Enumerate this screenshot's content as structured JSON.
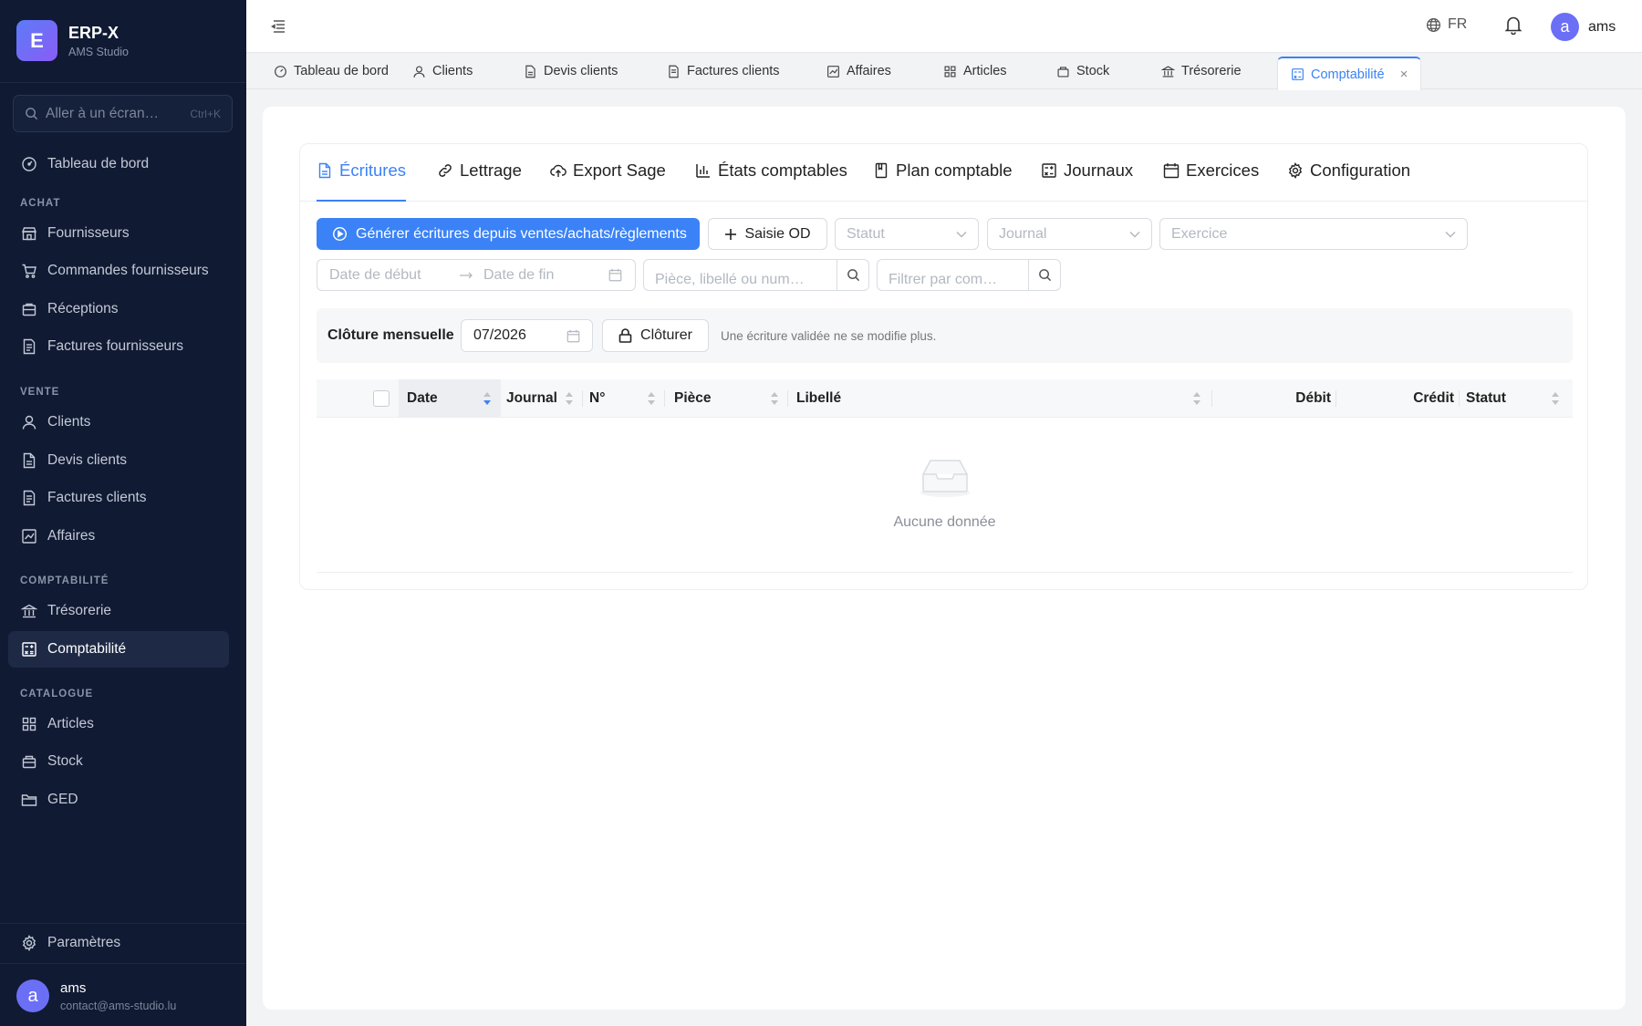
{
  "brand": {
    "logo_letter": "E",
    "name": "ERP-X",
    "subtitle": "AMS Studio"
  },
  "sidebar": {
    "search": {
      "placeholder": "Aller à un écran…",
      "shortcut": "Ctrl+K"
    },
    "top_item": {
      "label": "Tableau de bord",
      "icon": "dashboard-icon"
    },
    "sections": [
      {
        "title": "ACHAT",
        "items": [
          {
            "label": "Fournisseurs",
            "icon": "store-icon"
          },
          {
            "label": "Commandes fournisseurs",
            "icon": "cart-icon"
          },
          {
            "label": "Réceptions",
            "icon": "inbox-icon"
          },
          {
            "label": "Factures fournisseurs",
            "icon": "invoice-icon"
          }
        ]
      },
      {
        "title": "VENTE",
        "items": [
          {
            "label": "Clients",
            "icon": "user-icon"
          },
          {
            "label": "Devis clients",
            "icon": "file-icon"
          },
          {
            "label": "Factures clients",
            "icon": "invoice-icon"
          },
          {
            "label": "Affaires",
            "icon": "chart-line-icon"
          }
        ]
      },
      {
        "title": "COMPTABILITÉ",
        "items": [
          {
            "label": "Trésorerie",
            "icon": "bank-icon"
          },
          {
            "label": "Comptabilité",
            "icon": "calculator-icon",
            "active": true
          }
        ]
      },
      {
        "title": "CATALOGUE",
        "items": [
          {
            "label": "Articles",
            "icon": "grid-icon"
          },
          {
            "label": "Stock",
            "icon": "box-icon"
          },
          {
            "label": "GED",
            "icon": "folder-icon"
          }
        ]
      }
    ],
    "settings": {
      "label": "Paramètres",
      "icon": "gear-icon"
    },
    "user": {
      "initial": "a",
      "name": "ams",
      "email": "contact@ams-studio.lu"
    }
  },
  "header": {
    "language": "FR",
    "user_initial": "a",
    "user_name": "ams"
  },
  "tabs": [
    {
      "label": "Tableau de bord",
      "icon": "dashboard-icon"
    },
    {
      "label": "Clients",
      "icon": "user-icon"
    },
    {
      "label": "Devis clients",
      "icon": "file-icon"
    },
    {
      "label": "Factures clients",
      "icon": "invoice-icon"
    },
    {
      "label": "Affaires",
      "icon": "chart-line-icon"
    },
    {
      "label": "Articles",
      "icon": "grid-icon"
    },
    {
      "label": "Stock",
      "icon": "box-icon"
    },
    {
      "label": "Trésorerie",
      "icon": "bank-icon"
    },
    {
      "label": "Comptabilité",
      "icon": "calculator-icon",
      "active": true,
      "close": "×"
    }
  ],
  "subtabs": [
    {
      "label": "Écritures",
      "icon": "file-icon",
      "active": true
    },
    {
      "label": "Lettrage",
      "icon": "link-icon"
    },
    {
      "label": "Export Sage",
      "icon": "cloud-upload-icon"
    },
    {
      "label": "États comptables",
      "icon": "bar-chart-icon"
    },
    {
      "label": "Plan comptable",
      "icon": "book-icon"
    },
    {
      "label": "Journaux",
      "icon": "calculator-icon"
    },
    {
      "label": "Exercices",
      "icon": "calendar-icon"
    },
    {
      "label": "Configuration",
      "icon": "gear-icon"
    }
  ],
  "toolbar": {
    "generate_label": "Générer écritures depuis ventes/achats/règlements",
    "saisie_label": "Saisie OD",
    "status_placeholder": "Statut",
    "journal_placeholder": "Journal",
    "exercice_placeholder": "Exercice",
    "date_start_placeholder": "Date de début",
    "date_end_placeholder": "Date de fin",
    "search_placeholder": "Pièce, libellé ou num…",
    "compte_placeholder": "Filtrer par com…"
  },
  "cloture": {
    "label": "Clôture mensuelle",
    "month_value": "07/2026",
    "button_label": "Clôturer",
    "hint": "Une écriture validée ne se modifie plus."
  },
  "table": {
    "columns": [
      "Date",
      "Journal",
      "N°",
      "Pièce",
      "Libellé",
      "Débit",
      "Crédit",
      "Statut"
    ],
    "sorted_column": "Date",
    "rows": [],
    "empty_text": "Aucune donnée"
  },
  "colors": {
    "sidebar_bg": "#101a33",
    "accent": "#3b82f6",
    "avatar": "#6b6ff5"
  }
}
